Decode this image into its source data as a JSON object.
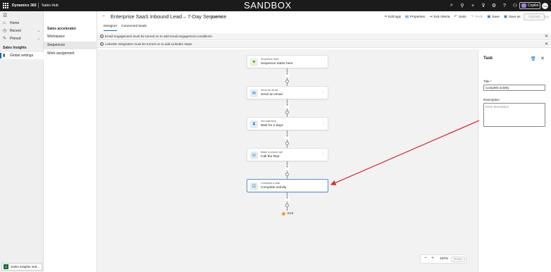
{
  "topbar": {
    "brand": "Dynamics 365",
    "app_name": "Sales Hub",
    "environment_banner": "SANDBOX",
    "icons": [
      "search-icon",
      "lightbulb-icon",
      "plus-icon",
      "filter-icon",
      "settings-icon",
      "help-icon",
      "people-icon"
    ],
    "icon_glyphs": [
      "⌕",
      "⚲",
      "+",
      "⊽",
      "⚙",
      "?",
      "⚇"
    ],
    "copilot_label": "Copilot",
    "avatar_initials": "SA"
  },
  "left_nav": {
    "items": [
      {
        "label": "Home",
        "icon": "home-icon",
        "glyph": "⌂"
      },
      {
        "label": "Recent",
        "icon": "clock-icon",
        "glyph": "◷"
      },
      {
        "label": "Pinned",
        "icon": "pin-icon",
        "glyph": "✎"
      }
    ],
    "section_title": "Sales Insights",
    "active_item": {
      "label": "Global settings",
      "icon": "settings-icon"
    },
    "area_switcher": {
      "badge": "S",
      "label": "Sales Insights sett..."
    }
  },
  "sub_nav": {
    "header": "Sales accelerator",
    "items": [
      "Workspace",
      "Sequences",
      "Work assignment"
    ],
    "active": "Sequences"
  },
  "command_bar": {
    "title": "Enterprise SaaS Inbound Lead – 7-Day Sequence",
    "status": "- Inactive",
    "commands": [
      {
        "label": "Edit tags",
        "icon": "tag-icon",
        "glyph": "⌗",
        "enabled": true
      },
      {
        "label": "Properties",
        "icon": "properties-icon",
        "glyph": "▤",
        "enabled": true
      },
      {
        "label": "Exit criteria",
        "icon": "exit-criteria-icon",
        "glyph": "⇥",
        "enabled": true
      },
      {
        "label": "Undo",
        "icon": "undo-icon",
        "glyph": "↶",
        "enabled": true
      },
      {
        "label": "Redo",
        "icon": "redo-icon",
        "glyph": "↷",
        "enabled": false
      },
      {
        "label": "Save",
        "icon": "save-icon",
        "glyph": "▣",
        "enabled": true
      },
      {
        "label": "Save as",
        "icon": "save-as-icon",
        "glyph": "▣",
        "enabled": true
      },
      {
        "label": "Create a copy",
        "icon": "copy-icon",
        "glyph": "⧉",
        "enabled": false
      }
    ],
    "activate_label": "Activate"
  },
  "tabs": [
    {
      "label": "Designer",
      "active": true
    },
    {
      "label": "Connected leads",
      "active": false
    }
  ],
  "banners": [
    "Email engagement must be turned on to add email engagement conditions.",
    "LinkedIn integration must be turned on to add LinkedIn steps."
  ],
  "sequence": {
    "steps": [
      {
        "type": "Sequence start",
        "name": "Sequence starts here",
        "icon": "flag-icon",
        "glyph": "⚑",
        "color": "#5aa02c",
        "bg": "#e6f3dc",
        "selected": false
      },
      {
        "type": "Send an email",
        "name": "Send an email",
        "icon": "email-icon",
        "glyph": "✉",
        "color": "#0f6cbd",
        "bg": "#e1ecf7",
        "selected": false
      },
      {
        "type": "Set wait time",
        "name": "Wait for 2 days",
        "icon": "hourglass-icon",
        "glyph": "⧗",
        "color": "#0f6cbd",
        "bg": "#e1ecf7",
        "selected": false
      },
      {
        "type": "Make a phone call",
        "name": "Call the Rep",
        "icon": "phone-icon",
        "glyph": "☏",
        "color": "#0f6cbd",
        "bg": "#e1ecf7",
        "selected": false
      },
      {
        "type": "Complete a task",
        "name": "Complete activity",
        "icon": "task-icon",
        "glyph": "☑",
        "color": "#0f6cbd",
        "bg": "#e1ecf7",
        "selected": true
      }
    ],
    "exit_label": "Exit"
  },
  "zoom": {
    "value": "100%",
    "reset_label": "Reset"
  },
  "task_panel": {
    "title": "Task",
    "title_field_label": "Title *",
    "title_field_value": "Complete activity",
    "description_label": "Description",
    "description_placeholder": "Enter description"
  },
  "colors": {
    "accent": "#0f6cbd",
    "annotation_arrow": "#d0353b",
    "topbar_bg": "#1b1b1b"
  }
}
